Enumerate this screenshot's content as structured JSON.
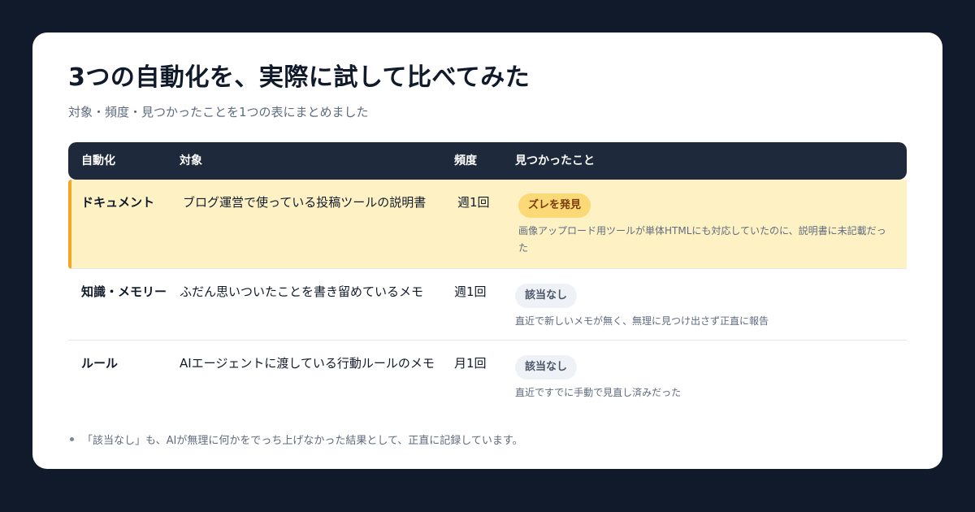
{
  "page": {
    "title": "3つの自動化を、実際に試して比べてみた",
    "subtitle": "対象・頻度・見つかったことを1つの表にまとめました"
  },
  "table": {
    "headers": [
      "自動化",
      "対象",
      "頻度",
      "見つかったこと"
    ],
    "rows": [
      {
        "name": "ドキュメント",
        "target": "ブログ運営で使っている投稿ツールの説明書",
        "frequency": "週1回",
        "badge": "ズレを発見",
        "badge_type": "warning",
        "note": "画像アップロード用ツールが単体HTMLにも対応していたのに、説明書に未記載だった"
      },
      {
        "name": "知識・メモリー",
        "target": "ふだん思いついたことを書き留めているメモ",
        "frequency": "週1回",
        "badge": "該当なし",
        "badge_type": "none",
        "note": "直近で新しいメモが無く、無理に見つけ出さず正直に報告"
      },
      {
        "name": "ルール",
        "target": "AIエージェントに渡している行動ルールのメモ",
        "frequency": "月1回",
        "badge": "該当なし",
        "badge_type": "none",
        "note": "直近ですでに手動で見直し済みだった"
      }
    ]
  },
  "footnote": "「該当なし」も、AIが無理に何かをでっち上げなかった結果として、正直に記録しています。",
  "colors": {
    "background": "#111a2b",
    "header": "#1e293b",
    "highlight_row": "#fef2c4",
    "highlight_accent": "#f5a623",
    "warning_badge": "#fbd977",
    "none_badge": "#eef1f5"
  }
}
